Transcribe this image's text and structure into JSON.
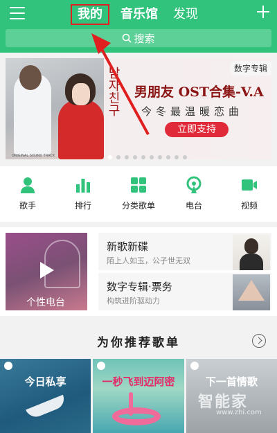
{
  "header": {
    "tabs": [
      {
        "label": "我的",
        "active": true
      },
      {
        "label": "音乐馆",
        "active": false
      },
      {
        "label": "发现",
        "active": false
      }
    ],
    "search_label": "搜索"
  },
  "banner": {
    "tag": "数字专辑",
    "title": "男朋友 OST合集-V.A",
    "subtitle": "今冬最温暖恋曲",
    "button": "立即支持",
    "vertical_text": "남자친구",
    "small_caption": "ORIGINAL SOUND TRACK"
  },
  "quick_nav": [
    {
      "label": "歌手",
      "icon": "singer-icon"
    },
    {
      "label": "排行",
      "icon": "ranking-icon"
    },
    {
      "label": "分类歌单",
      "icon": "category-icon"
    },
    {
      "label": "电台",
      "icon": "radio-icon"
    },
    {
      "label": "视频",
      "icon": "video-icon"
    }
  ],
  "personal_radio": {
    "label": "个性电台"
  },
  "cards": [
    {
      "title": "新歌新碟",
      "subtitle": "陌上人如玉，公子世无双"
    },
    {
      "title": "数字专辑·票务",
      "subtitle": "构筑进阶驱动力"
    }
  ],
  "recommend": {
    "title": "为你推荐歌单",
    "items": [
      {
        "label": "今日私享"
      },
      {
        "label": "一秒飞到迈阿密"
      },
      {
        "label": "下一首情歌"
      }
    ]
  },
  "watermark": {
    "text": "智能家",
    "url": "www.zhi.com"
  },
  "colors": {
    "accent": "#31c27c",
    "highlight_box": "#e02020",
    "button": "#e02a3a"
  }
}
